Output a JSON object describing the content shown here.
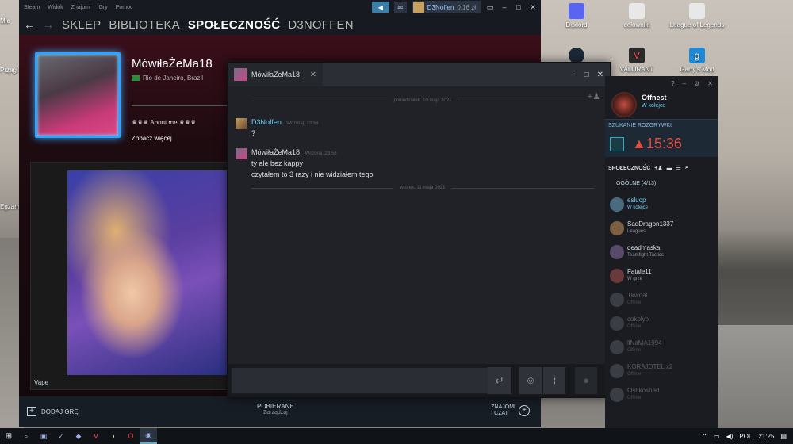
{
  "desktop": {
    "icons": [
      {
        "label": "Discord",
        "color": "#5865f2"
      },
      {
        "label": "celowniki",
        "color": "#e8e8e8"
      },
      {
        "label": "League of Legends",
        "color": "#e8e8e8"
      },
      {
        "label": "",
        "color": "#1b2838"
      },
      {
        "label": "VALORANT",
        "color": "#ff4655"
      },
      {
        "label": "Garry's Mod",
        "color": "#1e8ad6"
      }
    ],
    "left_labels": [
      "Mic",
      "Przegl",
      "Egzam"
    ]
  },
  "steam": {
    "menu": [
      "Steam",
      "Widok",
      "Znajomi",
      "Gry",
      "Pomoc"
    ],
    "user": "D3Noffen",
    "wallet": "0,16 zł",
    "nav": [
      "SKLEP",
      "BIBLIOTEKA",
      "SPOŁECZNOŚĆ",
      "D3NOFFEN"
    ],
    "profile": {
      "name": "MówiłaŻeMa18",
      "location": "Rio de Janeiro, Brazil",
      "about": "♛♛♛ About me ♛♛♛",
      "more": "Zobacz więcej",
      "showcase_caption": "Vape"
    },
    "bottom": {
      "add_game": "DODAJ GRĘ",
      "downloads": "POBIERANE",
      "downloads_sub": "Zarządzaj",
      "friends_chat_1": "ZNAJOMI",
      "friends_chat_2": "I CZAT"
    }
  },
  "chat": {
    "tab_name": "MówiłaŻeMa18",
    "dates": [
      "poniedziałek, 10 maja 2021",
      "wtorek, 11 maja 2021"
    ],
    "messages": [
      {
        "author": "D3Noffen",
        "time": "Wczoraj, 23:58",
        "lines": [
          "?"
        ]
      },
      {
        "author": "MówiłaŻeMa18",
        "time": "Wczoraj, 23:58",
        "lines": [
          "ty ale bez kappy",
          "czytałem to 3 razy i nie widziałem tego"
        ]
      }
    ]
  },
  "friends": {
    "self_name": "Offnest",
    "self_status": "W kolejce",
    "queue_label": "SZUKANIE ROZGRYWKI",
    "queue_timer": "15:36",
    "section": "SPOŁECZNOŚĆ",
    "group": "OGÓLNE (4/13)",
    "list": [
      {
        "name": "esluop",
        "status": "W kolejce",
        "state": "online"
      },
      {
        "name": "SadDragon1337",
        "status": "Leagues",
        "state": "away"
      },
      {
        "name": "deadmaska",
        "status": "Teamfight Tactics",
        "state": "away"
      },
      {
        "name": "Fatale11",
        "status": "W grze",
        "state": "away"
      },
      {
        "name": "Tkwoal",
        "status": "Offline",
        "state": "offline"
      },
      {
        "name": "cokolyb",
        "status": "Offline",
        "state": "offline"
      },
      {
        "name": "llNaMA1994",
        "status": "Offline",
        "state": "offline"
      },
      {
        "name": "KORAJDTEL x2",
        "status": "Offline",
        "state": "offline"
      },
      {
        "name": "Oshkoshed",
        "status": "Offline",
        "state": "offline"
      }
    ]
  },
  "taskbar": {
    "lang": "POL",
    "time": "21:25"
  }
}
